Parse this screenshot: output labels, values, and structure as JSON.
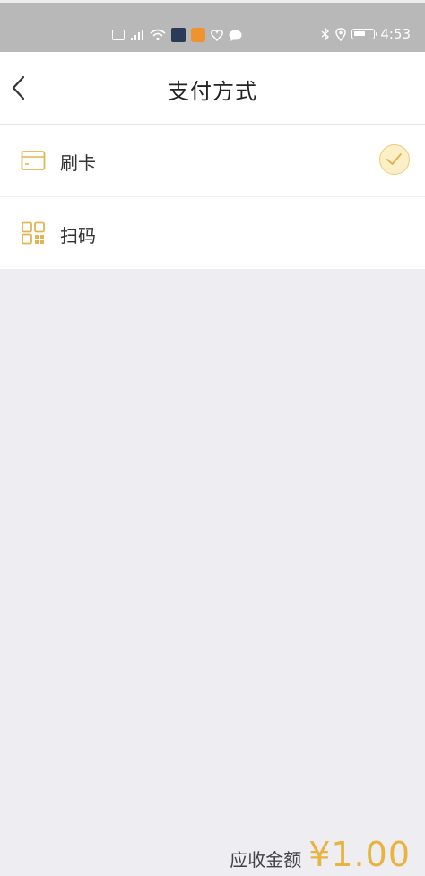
{
  "status_bar": {
    "time": "4:53",
    "left_icons": [
      "app-notification-icon",
      "signal-icon",
      "wifi-icon",
      "app-icon",
      "video-app-icon",
      "heart-icon",
      "message-icon"
    ],
    "right_icons": [
      "bluetooth-icon",
      "location-icon",
      "battery-icon"
    ]
  },
  "header": {
    "title": "支付方式",
    "back_icon": "back-chevron-icon"
  },
  "payment_methods": [
    {
      "label": "刷卡",
      "icon": "card-icon",
      "selected": true
    },
    {
      "label": "扫码",
      "icon": "qr-code-icon",
      "selected": false
    }
  ],
  "footer": {
    "amount_label": "应收金额",
    "amount_value": "¥1.00"
  },
  "colors": {
    "accent": "#e8b33f",
    "check_bg": "#fbefc8",
    "page_bg": "#eeedf2"
  }
}
